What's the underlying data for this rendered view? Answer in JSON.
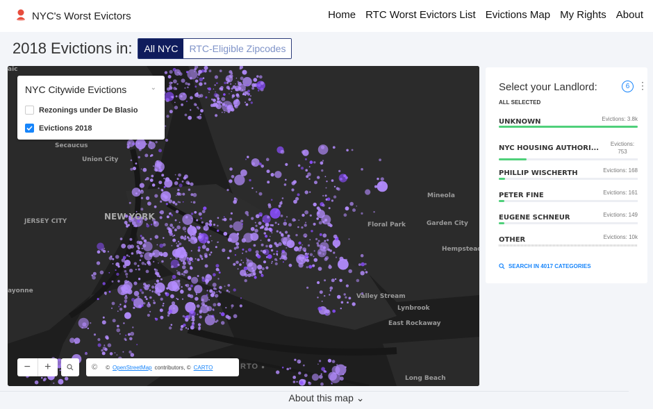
{
  "brand": {
    "title": "NYC's Worst Evictors",
    "accent": "#e74c3c"
  },
  "nav": [
    {
      "label": "Home"
    },
    {
      "label": "RTC Worst Evictors List"
    },
    {
      "label": "Evictions Map"
    },
    {
      "label": "My Rights"
    },
    {
      "label": "About"
    }
  ],
  "filter": {
    "title": "2018 Evictions in:",
    "options": [
      {
        "label": "All NYC",
        "active": true
      },
      {
        "label": "RTC-Eligible Zipcodes",
        "active": false
      }
    ],
    "active_color": "#0f1c5c"
  },
  "layers": {
    "selected": "NYC Citywide Evictions",
    "items": [
      {
        "label": "Rezonings under De Blasio",
        "checked": false
      },
      {
        "label": "Evictions 2018",
        "checked": true
      }
    ]
  },
  "map_labels": [
    {
      "text": "NEW YORK",
      "size": "big"
    },
    {
      "text": "JERSEY CITY"
    },
    {
      "text": "Secaucus"
    },
    {
      "text": "Union City"
    },
    {
      "text": "Mineola"
    },
    {
      "text": "Floral Park"
    },
    {
      "text": "Garden City"
    },
    {
      "text": "Hempstead"
    },
    {
      "text": "Valley Stream"
    },
    {
      "text": "Lynbrook"
    },
    {
      "text": "East Rockaway"
    },
    {
      "text": "Long Beach"
    },
    {
      "text": "ayonne"
    },
    {
      "text": "aic"
    }
  ],
  "map": {
    "zoom_out": "−",
    "zoom_in": "+",
    "attribution_prefix": "©",
    "attribution_c": "©",
    "osm_link": "OpenStreetMap",
    "attribution_mid": "contributors, ©",
    "carto_link": "CARTO",
    "carto_logo": "RTO",
    "dot_color": "#b48cff",
    "dot_dark": "#8a4dff"
  },
  "landlords": {
    "title": "Select your Landlord:",
    "count": "6",
    "all_selected": "ALL SELECTED",
    "categories": [
      {
        "name": "UNKNOWN",
        "value": "Evictions: 3.8k",
        "fill": 1.0
      },
      {
        "name": "NYC HOUSING AUTHORI...",
        "value": "Evictions: 753",
        "fill": 0.2
      },
      {
        "name": "PHILLIP WISCHERTH",
        "value": "Evictions: 168",
        "fill": 0.044
      },
      {
        "name": "PETER FINE",
        "value": "Evictions: 161",
        "fill": 0.042
      },
      {
        "name": "EUGENE SCHNEUR",
        "value": "Evictions: 149",
        "fill": 0.039
      },
      {
        "name": "OTHER",
        "value": "Evictions: 10k",
        "fill": 0
      }
    ],
    "search_label": "SEARCH IN 4017 CATEGORIES",
    "bar_color": "#4fd07a"
  },
  "footer": {
    "about": "About this map ⌄"
  }
}
